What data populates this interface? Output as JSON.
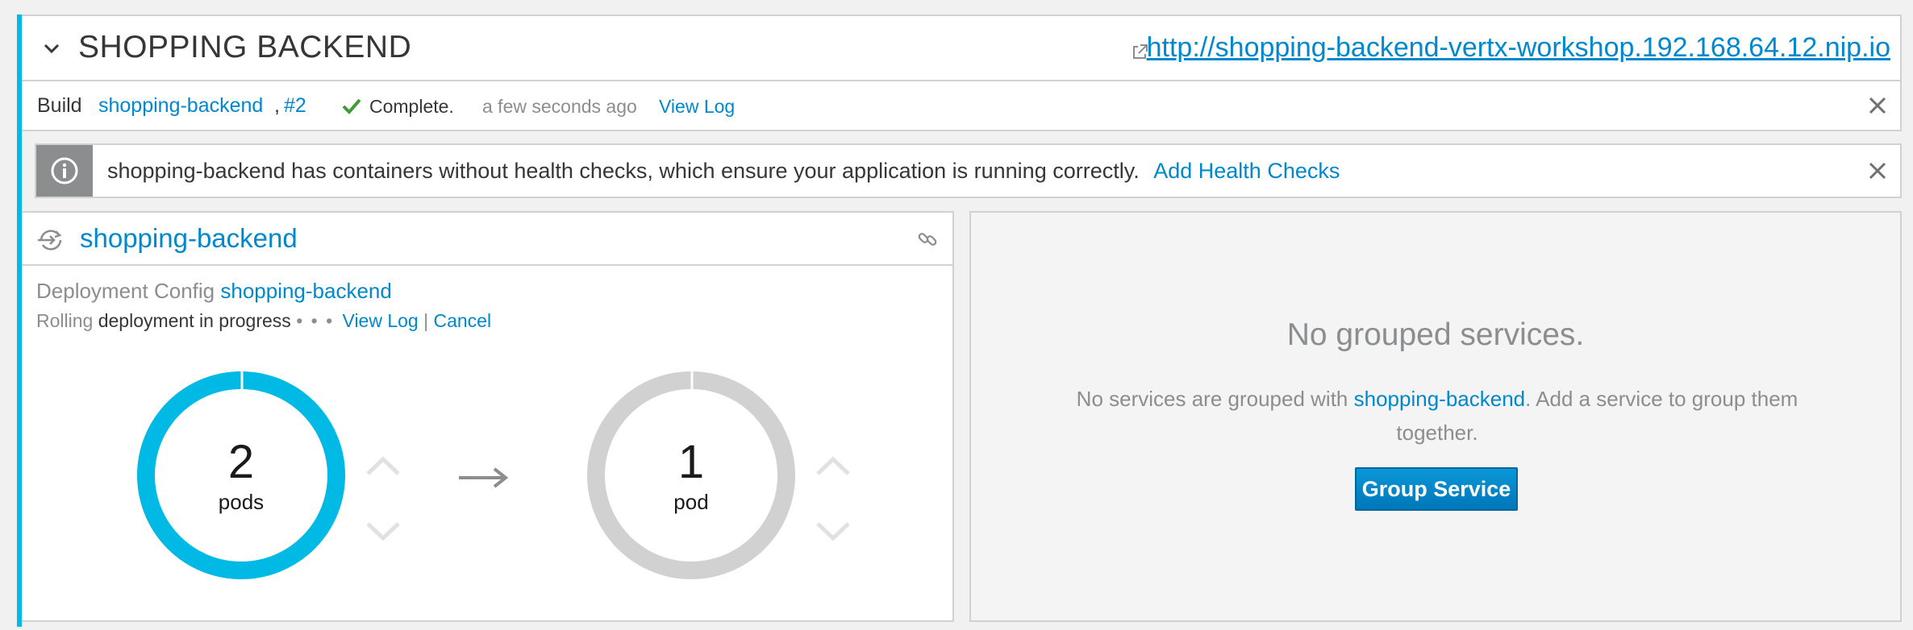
{
  "header": {
    "app_name": "SHOPPING BACKEND",
    "route_url": "http://shopping-backend-vertx-workshop.192.168.64.12.nip.io"
  },
  "build": {
    "prefix": "Build",
    "name": "shopping-backend",
    "separator": ",",
    "number": "#2",
    "status": "Complete.",
    "time": "a few seconds ago",
    "view_log": "View Log"
  },
  "alert": {
    "message": "shopping-backend has containers without health checks, which ensure your application is running correctly.",
    "action": "Add Health Checks"
  },
  "deployment": {
    "name": "shopping-backend",
    "config_label": "Deployment Config",
    "config_name": "shopping-backend",
    "strategy": "Rolling",
    "progress_text": "deployment in progress",
    "dots": "• • •",
    "view_log": "View Log",
    "divider": "|",
    "cancel": "Cancel",
    "old": {
      "count": "2",
      "label": "pods",
      "fraction": 1.0,
      "color": "#00b9e4"
    },
    "new": {
      "count": "1",
      "label": "pod",
      "fraction": 1.0,
      "color": "#d1d1d1"
    }
  },
  "grouped": {
    "title": "No grouped services.",
    "text_before": "No services are grouped with ",
    "service_link": "shopping-backend",
    "text_after": ". Add a service to group them together.",
    "button": "Group Service"
  },
  "colors": {
    "accent": "#00b9e4",
    "link": "#0088ce",
    "success": "#3f9c35",
    "muted": "#8b8d8f"
  }
}
